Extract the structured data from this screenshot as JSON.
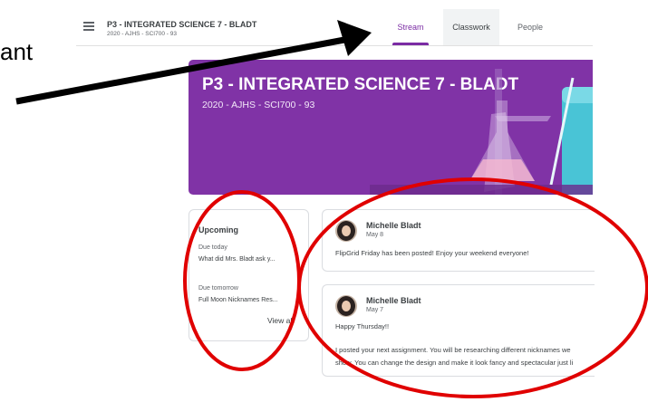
{
  "annotation": {
    "cut_text": "ant"
  },
  "header": {
    "class_title": "P3 - INTEGRATED SCIENCE 7 - BLADT",
    "class_subtitle": "2020 - AJHS - SCI700 - 93",
    "tabs": [
      {
        "label": "Stream",
        "active": true
      },
      {
        "label": "Classwork",
        "active": false
      },
      {
        "label": "People",
        "active": false
      }
    ]
  },
  "banner": {
    "title": "P3 - INTEGRATED SCIENCE 7 - BLADT",
    "subtitle": "2020 - AJHS - SCI700 - 93",
    "color": "#8033a6"
  },
  "upcoming": {
    "title": "Upcoming",
    "items": [
      {
        "due": "Due today",
        "task": "What did Mrs. Bladt ask y..."
      },
      {
        "due": "Due tomorrow",
        "task": "Full Moon Nicknames Res..."
      }
    ],
    "view_all": "View all"
  },
  "posts": [
    {
      "author": "Michelle Bladt",
      "date": "May 8",
      "lines": [
        "FlipGrid Friday has been posted! Enjoy your weekend everyone!"
      ]
    },
    {
      "author": "Michelle Bladt",
      "date": "May 7",
      "lines": [
        "Happy Thursday!!",
        "I posted your next assignment. You will be researching different nicknames we",
        "show. You can change the design and make it look fancy and spectacular just li"
      ]
    }
  ],
  "colors": {
    "accent": "#7b2ca4",
    "annotation": "#e00000"
  }
}
